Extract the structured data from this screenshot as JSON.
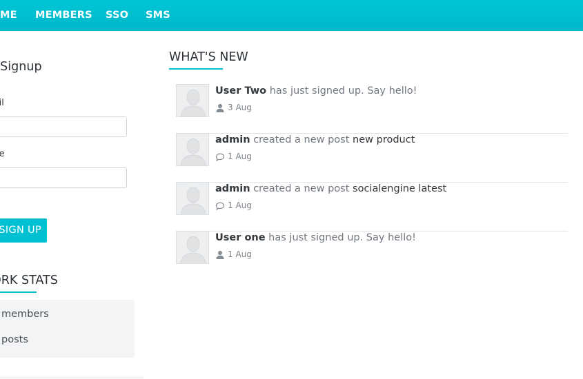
{
  "topnav": {
    "items": [
      {
        "label": "ME"
      },
      {
        "label": "MEMBERS"
      },
      {
        "label": "SSO"
      },
      {
        "label": "SMS"
      }
    ]
  },
  "sidebar": {
    "quick_signup": {
      "title": "ick Signup",
      "email_label": "mail",
      "name_label": "ame",
      "signup_button": "SIGN UP"
    },
    "network_stats": {
      "title": "TWORK STATS",
      "items": [
        {
          "label": "members"
        },
        {
          "label": "posts"
        }
      ]
    }
  },
  "whats_new": {
    "title": "WHAT'S NEW",
    "feed": [
      {
        "actor": "User Two",
        "action": " has just signed up. Say hello!",
        "object": "",
        "time": "3 Aug",
        "icon": "user-icon"
      },
      {
        "actor": "admin",
        "action": " created a new post ",
        "object": "new product",
        "time": "1 Aug",
        "icon": "comment-icon"
      },
      {
        "actor": "admin",
        "action": " created a new post ",
        "object": "socialengine latest",
        "time": "1 Aug",
        "icon": "comment-icon"
      },
      {
        "actor": "User one",
        "action": " has just signed up. Say hello!",
        "object": "",
        "time": "1 Aug",
        "icon": "user-icon"
      }
    ]
  },
  "colors": {
    "accent": "#00c0d1",
    "text_dark": "#34393e",
    "text_muted": "#717780",
    "panel_bg": "#f2f4f5"
  }
}
